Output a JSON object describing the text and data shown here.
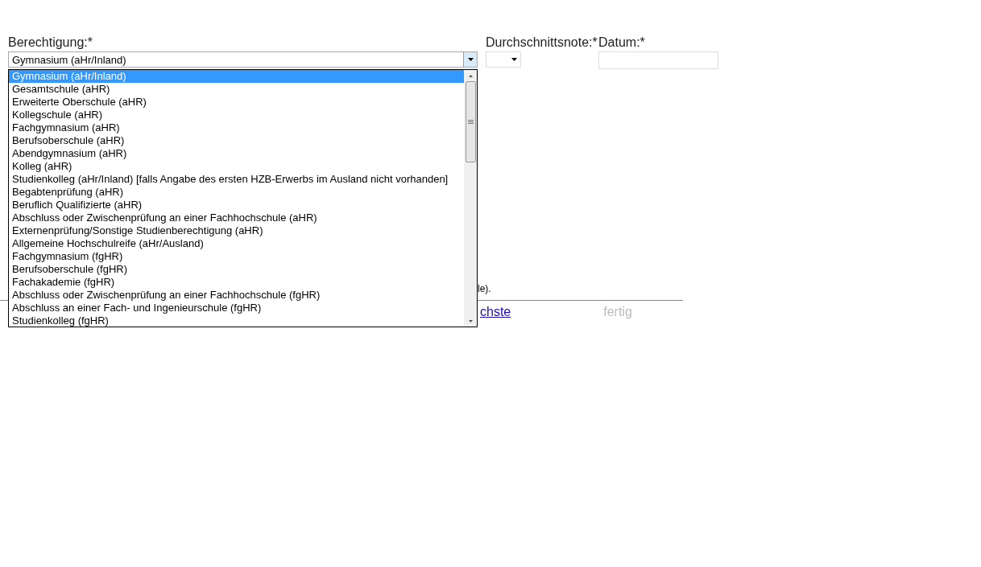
{
  "berechtigung": {
    "label": "Berechtigung:*",
    "value": "Gymnasium (aHr/Inland)",
    "expanded": true,
    "options": [
      {
        "label": "Gymnasium (aHr/Inland)",
        "selected": true
      },
      {
        "label": "Gesamtschule (aHR)",
        "selected": false
      },
      {
        "label": "Erweiterte Oberschule (aHR)",
        "selected": false
      },
      {
        "label": "Kollegschule (aHR)",
        "selected": false
      },
      {
        "label": "Fachgymnasium (aHR)",
        "selected": false
      },
      {
        "label": "Berufsoberschule (aHR)",
        "selected": false
      },
      {
        "label": "Abendgymnasium (aHR)",
        "selected": false
      },
      {
        "label": "Kolleg (aHR)",
        "selected": false
      },
      {
        "label": "Studienkolleg (aHr/Inland) [falls Angabe des ersten HZB-Erwerbs im Ausland nicht vorhanden]",
        "selected": false
      },
      {
        "label": "Begabtenprüfung (aHR)",
        "selected": false
      },
      {
        "label": "Beruflich Qualifizierte (aHR)",
        "selected": false
      },
      {
        "label": "Abschluss oder Zwischenprüfung an einer Fachhochschule (aHR)",
        "selected": false
      },
      {
        "label": "Externenprüfung/Sonstige Studienberechtigung (aHR)",
        "selected": false
      },
      {
        "label": "Allgemeine Hochschulreife (aHr/Ausland)",
        "selected": false
      },
      {
        "label": "Fachgymnasium (fgHR)",
        "selected": false
      },
      {
        "label": "Berufsoberschule (fgHR)",
        "selected": false
      },
      {
        "label": "Fachakademie (fgHR)",
        "selected": false
      },
      {
        "label": "Abschluss oder Zwischenprüfung an einer Fachhochschule (fgHR)",
        "selected": false
      },
      {
        "label": "Abschluss an einer Fach- und Ingenieurschule (fgHR)",
        "selected": false
      },
      {
        "label": "Studienkolleg (fgHR)",
        "selected": false
      }
    ]
  },
  "durchschnittsnote": {
    "label": "Durchschnittsnote:*"
  },
  "datum": {
    "label": "Datum:*"
  },
  "note_fragment": "le).",
  "navigation": [
    {
      "label": "chste",
      "disabled": false
    },
    {
      "label": "fertig",
      "disabled": true
    }
  ]
}
